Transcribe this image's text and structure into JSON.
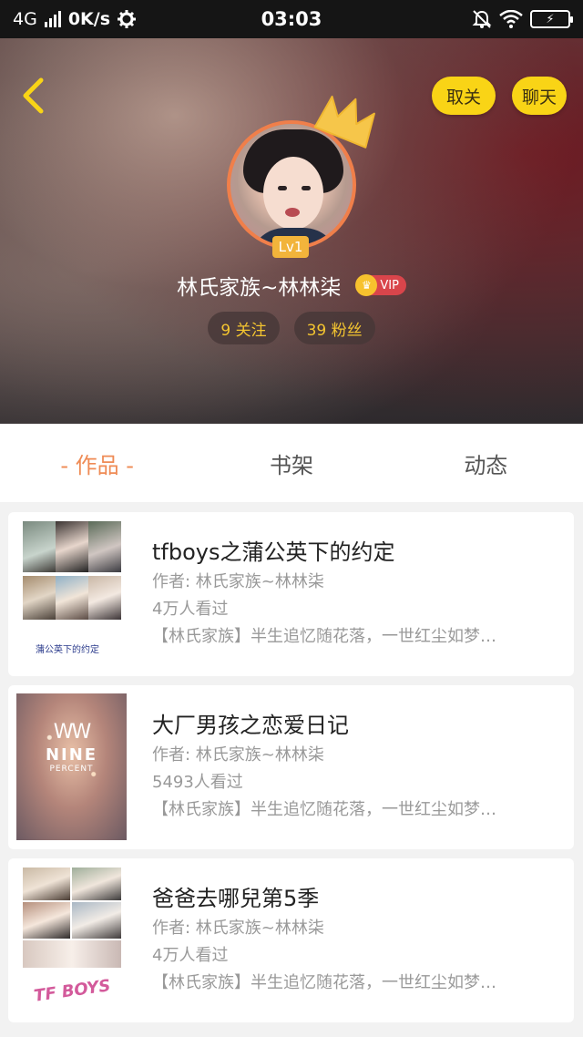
{
  "status_bar": {
    "network": "4G",
    "speed": "0K/s",
    "time": "03:03"
  },
  "header": {
    "unfollow_label": "取关",
    "chat_label": "聊天",
    "level": "Lv1",
    "username": "林氏家族~林林柒",
    "vip_label": "VIP",
    "following": "9 关注",
    "followers": "39 粉丝"
  },
  "tabs": [
    {
      "label": "- 作品 -",
      "active": true
    },
    {
      "label": "书架",
      "active": false
    },
    {
      "label": "动态",
      "active": false
    }
  ],
  "books": [
    {
      "title": "tfboys之蒲公英下的约定",
      "author": "作者: 林氏家族~林林柒",
      "views": "4万人看过",
      "desc": "【林氏家族】半生追忆随花落，一世红尘如梦…",
      "cover_caption": "蒲公英下的约定"
    },
    {
      "title": "大厂男孩之恋爱日记",
      "author": "作者: 林氏家族~林林柒",
      "views": "5493人看过",
      "desc": "【林氏家族】半生追忆随花落，一世红尘如梦…",
      "cover_logo": "NINE",
      "cover_logo_sub": "PERCENT"
    },
    {
      "title": "爸爸去哪兒第5季",
      "author": "作者: 林氏家族~林林柒",
      "views": "4万人看过",
      "desc": "【林氏家族】半生追忆随花落，一世红尘如梦…",
      "cover_caption": "TF BOYS"
    }
  ],
  "colors": {
    "accent_yellow": "#f9d416",
    "active_tab": "#ef8b55",
    "stat_text": "#f4c530",
    "avatar_ring": "#f07f4a",
    "vip_badge": "#d9454b"
  },
  "icons": {
    "back": "chevron-left-icon",
    "crown": "crown-icon",
    "settings": "gear-icon",
    "mute": "bell-off-icon",
    "wifi": "wifi-icon",
    "battery": "battery-charging-icon"
  }
}
